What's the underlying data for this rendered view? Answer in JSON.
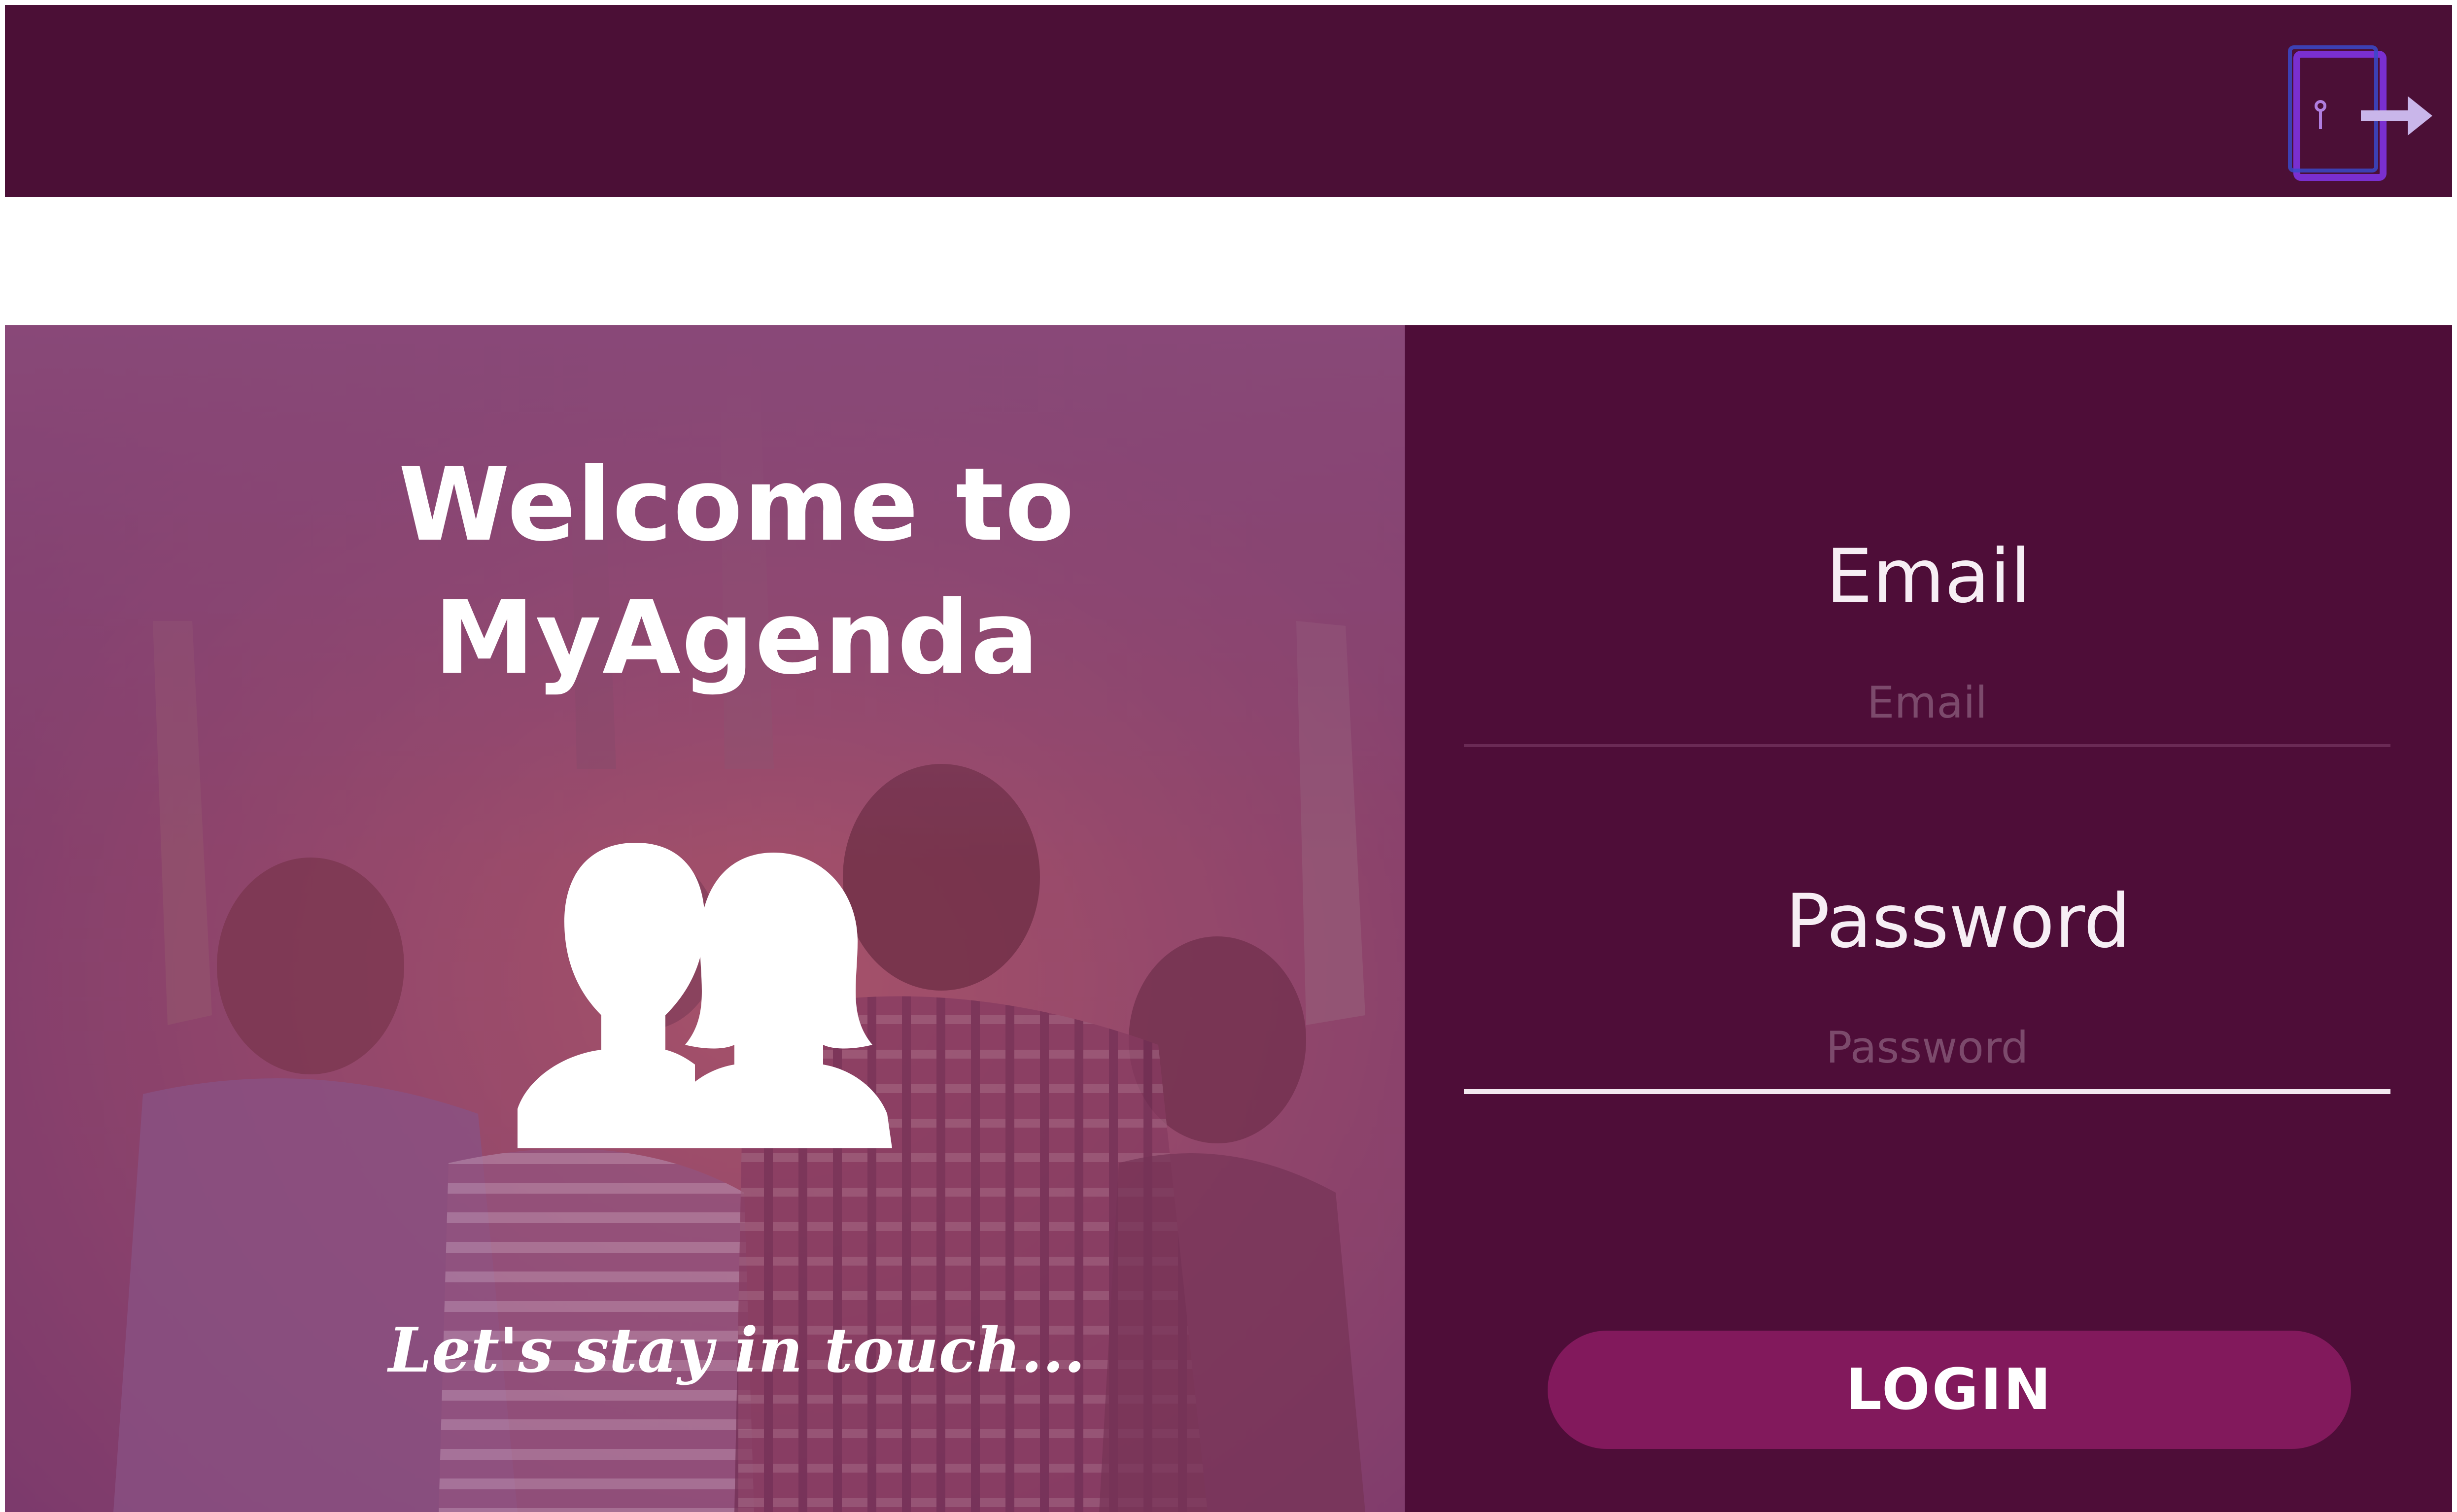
{
  "header": {
    "exit_icon": "exit-door-icon",
    "background_color": "#4b0f36"
  },
  "welcome": {
    "title_line1": "Welcome to",
    "title_line2": "MyAgenda",
    "users_icon": "users-icon",
    "tagline": "Let's stay in touch...",
    "overlay_color": "#7d3a6c"
  },
  "login": {
    "email_label": "Email",
    "email_placeholder": "Email",
    "password_label": "Password",
    "password_placeholder": "Password",
    "login_button": "LOGIN",
    "panel_color": "#4e0d38",
    "button_color": "#82195c"
  }
}
